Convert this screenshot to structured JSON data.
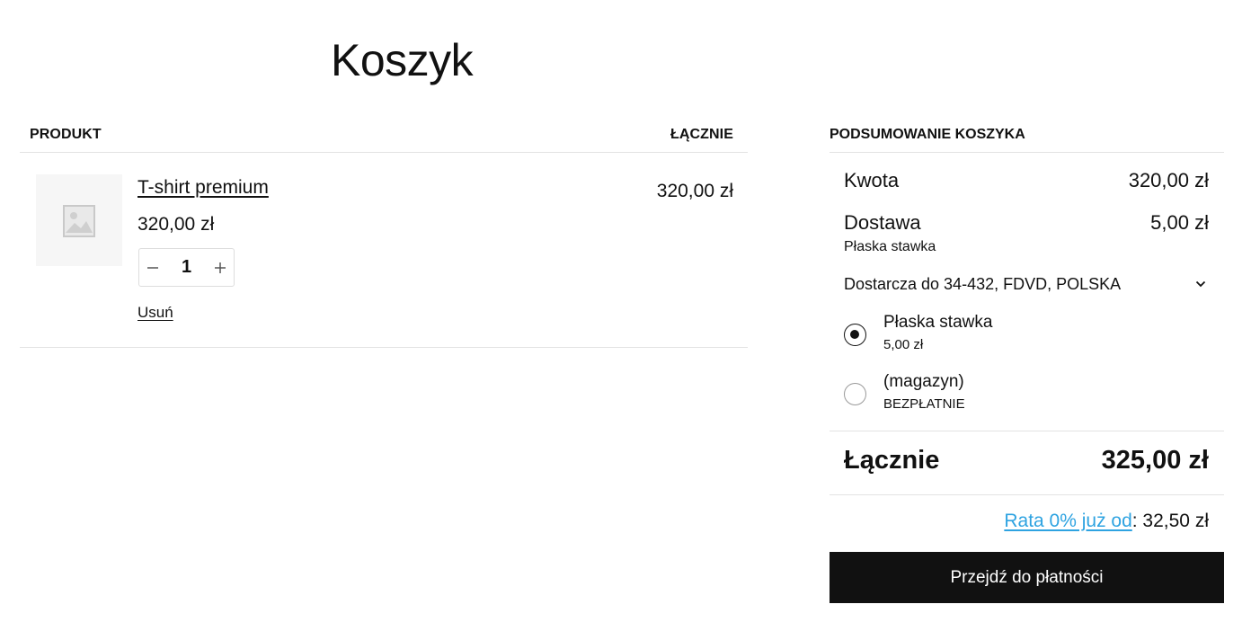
{
  "page": {
    "title": "Koszyk"
  },
  "cart": {
    "header": {
      "product": "PRODUKT",
      "total": "ŁĄCZNIE"
    },
    "items": [
      {
        "name": "T-shirt premium",
        "price": "320,00 zł",
        "quantity": "1",
        "remove_label": "Usuń",
        "line_total": "320,00 zł",
        "thumbnail_icon": "image-placeholder-icon"
      }
    ]
  },
  "summary": {
    "title": "PODSUMOWANIE KOSZYKA",
    "subtotal": {
      "label": "Kwota",
      "value": "320,00 zł"
    },
    "shipping": {
      "label": "Dostawa",
      "value": "5,00 zł",
      "method": "Płaska stawka",
      "destination": "Dostarcza do 34-432, FDVD, POLSKA",
      "options": [
        {
          "name": "Płaska stawka",
          "price": "5,00 zł",
          "selected": true
        },
        {
          "name": "(magazyn)",
          "price": "BEZPŁATNIE",
          "selected": false
        }
      ]
    },
    "total": {
      "label": "Łącznie",
      "value": "325,00 zł"
    },
    "installment": {
      "link_text": "Rata 0% już od",
      "suffix": ": 32,50 zł"
    },
    "checkout_label": "Przejdź do płatności"
  },
  "colors": {
    "accent": "#2ea3e1",
    "button_bg": "#111111",
    "divider": "#e3e3e3"
  }
}
